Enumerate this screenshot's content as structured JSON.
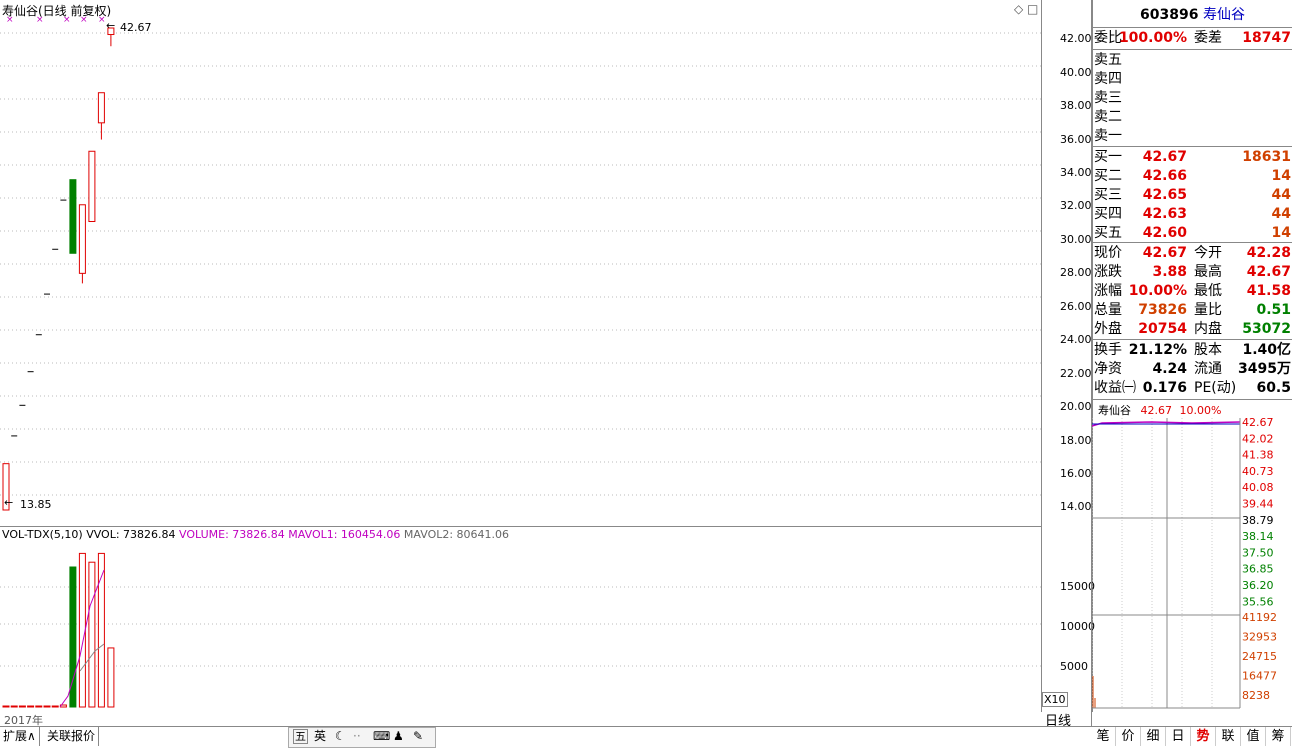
{
  "chart_title": "寿仙谷(日线 前复权)",
  "price_hi_label": "42.67",
  "price_lo_label": "13.85",
  "price_axis": [
    "42.00",
    "40.00",
    "38.00",
    "36.00",
    "34.00",
    "32.00",
    "30.00",
    "28.00",
    "26.00",
    "24.00",
    "22.00",
    "20.00",
    "18.00",
    "16.00",
    "14.00"
  ],
  "vol_header": {
    "label": "VOL-TDX(5,10)",
    "vvol": "VVOL: 73826.84",
    "volume": "VOLUME: 73826.84",
    "mavol1": "MAVOL1: 160454.06",
    "mavol2": "MAVOL2: 80641.06"
  },
  "vol_axis": [
    "15000",
    "10000",
    "5000"
  ],
  "vol_unit": "X10",
  "year_label": "2017年",
  "period_label": "日线",
  "chart_data": {
    "type": "candlestick",
    "title": "寿仙谷(日线 前复权)",
    "ylim": [
      13,
      43
    ],
    "candles": [
      {
        "open": 13.85,
        "close": 16.62,
        "high": 16.62,
        "low": 13.85
      },
      {
        "open": 18.28,
        "close": 18.28,
        "high": 18.28,
        "low": 18.28
      },
      {
        "open": 20.11,
        "close": 20.11,
        "high": 20.11,
        "low": 20.11
      },
      {
        "open": 22.12,
        "close": 22.12,
        "high": 22.12,
        "low": 22.12
      },
      {
        "open": 24.33,
        "close": 24.33,
        "high": 24.33,
        "low": 24.33
      },
      {
        "open": 26.76,
        "close": 26.76,
        "high": 26.76,
        "low": 26.76
      },
      {
        "open": 29.44,
        "close": 29.44,
        "high": 29.44,
        "low": 29.44
      },
      {
        "open": 32.38,
        "close": 32.38,
        "high": 32.38,
        "low": 32.38
      },
      {
        "open": 33.6,
        "close": 29.2,
        "high": 33.6,
        "low": 29.2
      },
      {
        "open": 28.0,
        "close": 32.1,
        "high": 32.1,
        "low": 27.4
      },
      {
        "open": 31.1,
        "close": 35.3,
        "high": 35.3,
        "low": 31.1
      },
      {
        "open": 37.0,
        "close": 38.8,
        "high": 38.8,
        "low": 36.0
      },
      {
        "open": 42.28,
        "close": 42.67,
        "high": 42.67,
        "low": 41.58
      }
    ],
    "volume": [
      20,
      20,
      20,
      20,
      20,
      20,
      30,
      250,
      17500,
      19200,
      18100,
      19200,
      7383
    ],
    "vol_ylim": [
      0,
      20000
    ]
  },
  "quote": {
    "code": "603896",
    "name": "寿仙谷",
    "weibi_label": "委比",
    "weibi": "100.00%",
    "weicha_label": "委差",
    "weicha": "18747",
    "asks": [
      {
        "label": "卖五",
        "price": "",
        "vol": ""
      },
      {
        "label": "卖四",
        "price": "",
        "vol": ""
      },
      {
        "label": "卖三",
        "price": "",
        "vol": ""
      },
      {
        "label": "卖二",
        "price": "",
        "vol": ""
      },
      {
        "label": "卖一",
        "price": "",
        "vol": ""
      }
    ],
    "bids": [
      {
        "label": "买一",
        "price": "42.67",
        "vol": "18631"
      },
      {
        "label": "买二",
        "price": "42.66",
        "vol": "14"
      },
      {
        "label": "买三",
        "price": "42.65",
        "vol": "44"
      },
      {
        "label": "买四",
        "price": "42.63",
        "vol": "44"
      },
      {
        "label": "买五",
        "price": "42.60",
        "vol": "14"
      }
    ],
    "stats1": [
      {
        "l1": "现价",
        "v1": "42.67",
        "l2": "今开",
        "v2": "42.28",
        "c1": "red",
        "c2": "red"
      },
      {
        "l1": "涨跌",
        "v1": "3.88",
        "l2": "最高",
        "v2": "42.67",
        "c1": "red",
        "c2": "red"
      },
      {
        "l1": "涨幅",
        "v1": "10.00%",
        "l2": "最低",
        "v2": "41.58",
        "c1": "red",
        "c2": "red"
      },
      {
        "l1": "总量",
        "v1": "73826",
        "l2": "量比",
        "v2": "0.51",
        "c1": "orange",
        "c2": "green"
      },
      {
        "l1": "外盘",
        "v1": "20754",
        "l2": "内盘",
        "v2": "53072",
        "c1": "red",
        "c2": "green"
      }
    ],
    "stats2": [
      {
        "l1": "换手",
        "v1": "21.12%",
        "l2": "股本",
        "v2": "1.40亿"
      },
      {
        "l1": "净资",
        "v1": "4.24",
        "l2": "流通",
        "v2": "3495万"
      },
      {
        "l1": "收益㈠",
        "v1": "0.176",
        "l2": "PE(动)",
        "v2": "60.5"
      }
    ]
  },
  "mini": {
    "name": "寿仙谷",
    "price": "42.67",
    "pct": "10.00%",
    "price_axis": [
      "42.67",
      "42.02",
      "41.38",
      "40.73",
      "40.08",
      "39.44",
      "38.79",
      "38.14",
      "37.50",
      "36.85",
      "36.20",
      "35.56"
    ],
    "vol_axis": [
      "41192",
      "32953",
      "24715",
      "16477",
      "8238"
    ]
  },
  "left_tabs": [
    "扩展∧",
    "关联报价"
  ],
  "toolbar": [
    "五",
    "英"
  ],
  "right_tabs": [
    "笔",
    "价",
    "细",
    "日",
    "势",
    "联",
    "值",
    "筹"
  ]
}
